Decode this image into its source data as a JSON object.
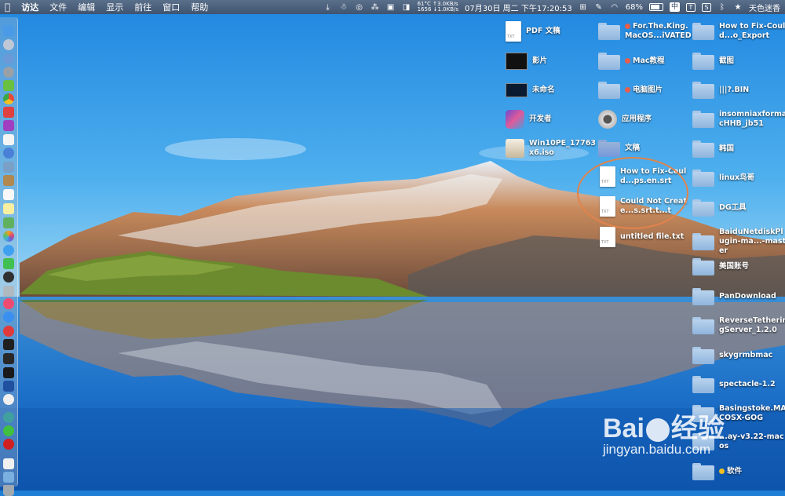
{
  "menubar": {
    "apple": "",
    "app": "访达",
    "menus": [
      "文件",
      "编辑",
      "显示",
      "前往",
      "窗口",
      "帮助"
    ],
    "net_up": "61°C ↑3.0KB/s",
    "net_down": "1656 ↓1.0KB/s",
    "datetime": "07月30日 周二 下午17:20:53",
    "battery": "68%",
    "input_method": "中",
    "user": "天色迷香"
  },
  "desktop": {
    "col1": [
      {
        "label": "PDF 文稿",
        "icon": "pdf-doc-icon"
      },
      {
        "label": "影片",
        "icon": "movie-icon"
      },
      {
        "label": "未命名",
        "icon": "image-icon"
      },
      {
        "label": "开发者",
        "icon": "developer-icon"
      },
      {
        "label": "Win10PE_17763x6.iso",
        "icon": "disk-image-icon"
      }
    ],
    "col2": [
      {
        "label": "For.The.King.MacOS...iVATED",
        "icon": "folder-icon",
        "tag": true
      },
      {
        "label": "Mac教程",
        "icon": "folder-icon",
        "tag": true
      },
      {
        "label": "电脑图片",
        "icon": "folder-icon",
        "tag": true
      },
      {
        "label": "应用程序",
        "icon": "applications-icon"
      },
      {
        "label": "文稿",
        "icon": "documents-folder-icon"
      },
      {
        "label": "How to Fix-Could...ps.en.srt",
        "icon": "text-file-icon"
      },
      {
        "label": "Could Not Create...s.srt.t...t",
        "icon": "text-file-icon"
      },
      {
        "label": "untitled file.txt",
        "icon": "text-file-icon"
      }
    ],
    "col3": [
      {
        "label": "How to Fix-Could...o_Export",
        "icon": "folder-icon"
      },
      {
        "label": "截图",
        "icon": "folder-icon"
      },
      {
        "label": "|||?.BIN",
        "icon": "folder-icon"
      },
      {
        "label": "insomniaxformacHHB_jb51",
        "icon": "folder-icon"
      },
      {
        "label": "韩国",
        "icon": "folder-icon"
      },
      {
        "label": "linux鸟哥",
        "icon": "folder-icon"
      },
      {
        "label": "DG工具",
        "icon": "folder-icon"
      },
      {
        "label": "BaiduNetdiskPlugin-ma...-master",
        "icon": "folder-icon"
      },
      {
        "label": "美国账号",
        "icon": "folder-icon"
      },
      {
        "label": "PanDownload",
        "icon": "folder-icon"
      },
      {
        "label": "ReverseTetheringServer_1.2.0",
        "icon": "folder-icon"
      },
      {
        "label": "skygrmbmac",
        "icon": "folder-icon"
      },
      {
        "label": "spectacle-1.2",
        "icon": "folder-icon"
      },
      {
        "label": "Basingstoke.MACOSX-GOG",
        "icon": "folder-icon"
      },
      {
        "label": "...ay-v3.22-macos",
        "icon": "folder-icon"
      },
      {
        "label": "软件",
        "icon": "folder-icon"
      }
    ]
  },
  "watermark": {
    "main_left": "Bai",
    "main_right": "经验",
    "url": "jingyan.baidu.com"
  },
  "colors": {
    "menubar": "#4a5f7b",
    "annotation": "#e2834a",
    "folder": "#a9c7e6"
  }
}
